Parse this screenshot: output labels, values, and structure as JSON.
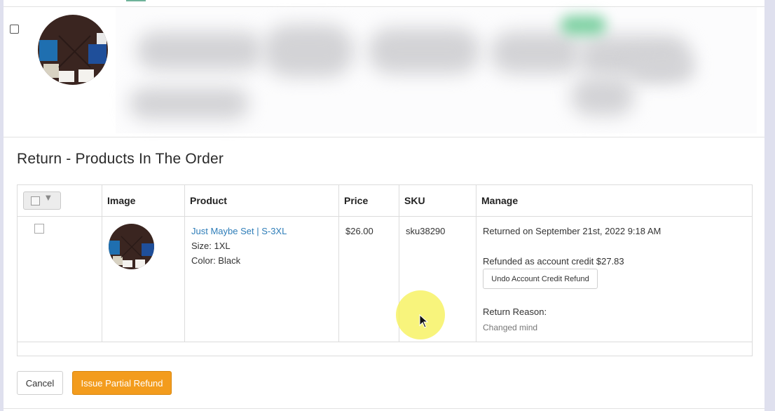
{
  "section": {
    "title": "Return - Products In The Order"
  },
  "table": {
    "headers": {
      "image": "Image",
      "product": "Product",
      "price": "Price",
      "sku": "SKU",
      "manage": "Manage"
    },
    "rows": [
      {
        "product_name": "Just Maybe Set | S-3XL",
        "size": "Size: 1XL",
        "color": "Color: Black",
        "price": "$26.00",
        "sku": "sku38290",
        "returned_on": "Returned on September 21st, 2022 9:18 AM",
        "refunded": "Refunded as account credit $27.83",
        "undo_button": "Undo Account Credit Refund",
        "reason_label": "Return Reason:",
        "reason_value": "Changed mind"
      }
    ]
  },
  "actions": {
    "cancel": "Cancel",
    "issue_partial_refund": "Issue Partial Refund"
  },
  "colors": {
    "primary_button": "#f39c1d",
    "link": "#2e7db8",
    "cursor_highlight": "#f5f050"
  },
  "icons": {
    "bulk_select": "checkbox-dropdown-icon",
    "cursor": "mouse-pointer-icon"
  }
}
